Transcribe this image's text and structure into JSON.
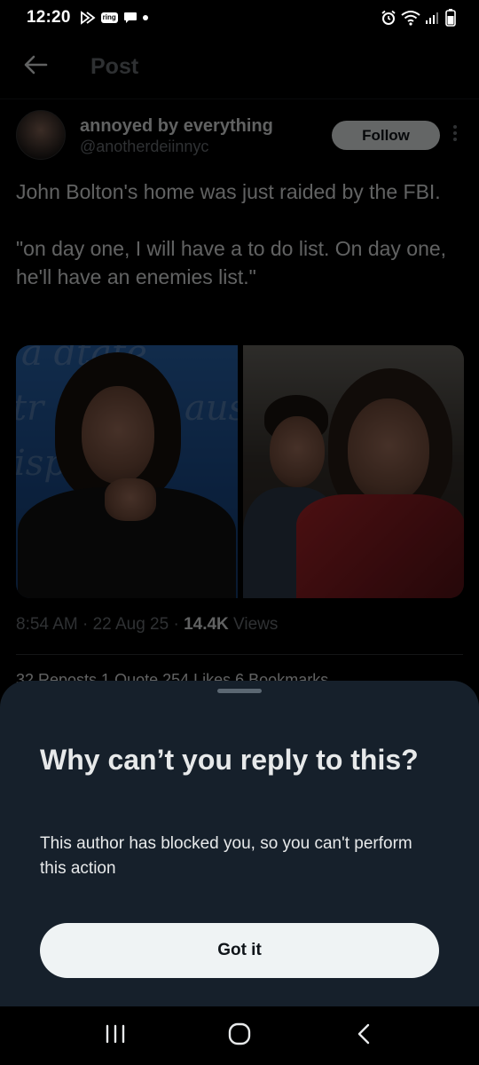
{
  "status_bar": {
    "time": "12:20",
    "ring_badge": "ring",
    "left_icons": [
      "play-icon",
      "ring-icon",
      "chat-bubble-icon",
      "dot-icon"
    ],
    "right_icons": [
      "alarm-icon",
      "wifi-icon",
      "signal-icon",
      "battery-icon"
    ]
  },
  "header": {
    "title": "Post",
    "back_icon": "arrow-left-icon"
  },
  "tweet": {
    "display_name": "annoyed by everything",
    "handle": "@anotherdeiinnyc",
    "follow_label": "Follow",
    "text": "John Bolton's home was just raided by the FBI.\n\n\"on day one, I will have a to do list. On day one, he'll have an enemies list.\"",
    "meta_time": "8:54 AM · 22 Aug 25 · ",
    "views_count": "14.4K",
    "views_label": " Views",
    "stats_peek": "32 Reposts   1 Quote   254 Likes   6 Bookmarks"
  },
  "sheet": {
    "title": "Why can’t you reply to this?",
    "description": "This author has blocked you, so you can't perform this action",
    "button_label": "Got it"
  },
  "navbar": {
    "icons": [
      "recent-apps-icon",
      "home-icon",
      "back-icon"
    ]
  },
  "colors": {
    "background": "#000000",
    "sheet_background": "#16202b",
    "button_background": "#eff3f4",
    "secondary_text": "#71767b"
  }
}
